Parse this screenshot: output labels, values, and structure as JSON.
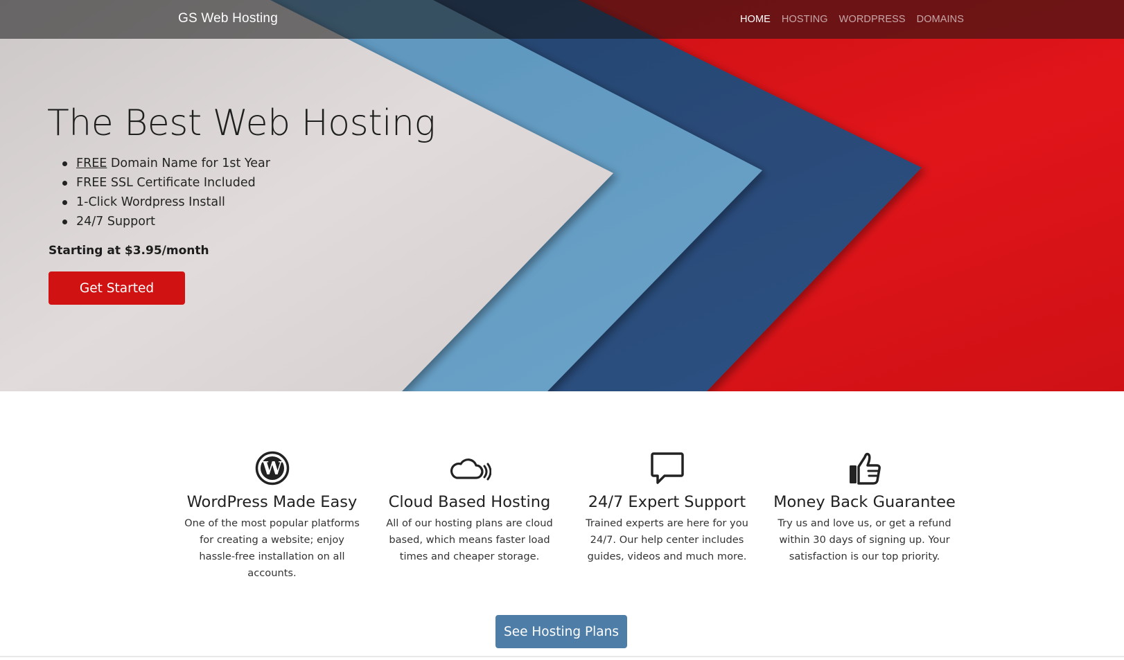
{
  "nav": {
    "brand": "GS Web Hosting",
    "links": [
      {
        "label": "HOME",
        "active": true
      },
      {
        "label": "HOSTING",
        "active": false
      },
      {
        "label": "WORDPRESS",
        "active": false
      },
      {
        "label": "DOMAINS",
        "active": false
      }
    ]
  },
  "hero": {
    "title": "The Best Web Hosting",
    "features": [
      {
        "highlight": "FREE",
        "rest": " Domain Name for 1st Year"
      },
      {
        "text": "FREE SSL Certificate Included"
      },
      {
        "text": "1-Click Wordpress Install"
      },
      {
        "text": "24/7 Support"
      }
    ],
    "price": "Starting at $3.95/month",
    "cta": "Get Started",
    "colors": {
      "red": "#d01212",
      "navy": "#2c4f7c",
      "steel_blue": "#5a9bc7",
      "paper": "#dcd6d6"
    }
  },
  "features": [
    {
      "icon": "wordpress-icon",
      "title": "WordPress Made Easy",
      "text": "One of the most popular platforms for creating a website; enjoy hassle-free installation on all accounts."
    },
    {
      "icon": "cloud-icon",
      "title": "Cloud Based Hosting",
      "text": "All of our hosting plans are cloud based, which means faster load times and cheaper storage."
    },
    {
      "icon": "chat-bubble-icon",
      "title": "24/7 Expert Support",
      "text": "Trained experts are here for you 24/7. Our help center includes guides, videos and much more."
    },
    {
      "icon": "thumbs-up-icon",
      "title": "Money Back Guarantee",
      "text": "Try us and love us, or get a refund within 30 days of signing up. Your satisfaction is our top priority."
    }
  ],
  "plans_button": "See Hosting Plans",
  "plans_button_color": "#4e7ea8"
}
